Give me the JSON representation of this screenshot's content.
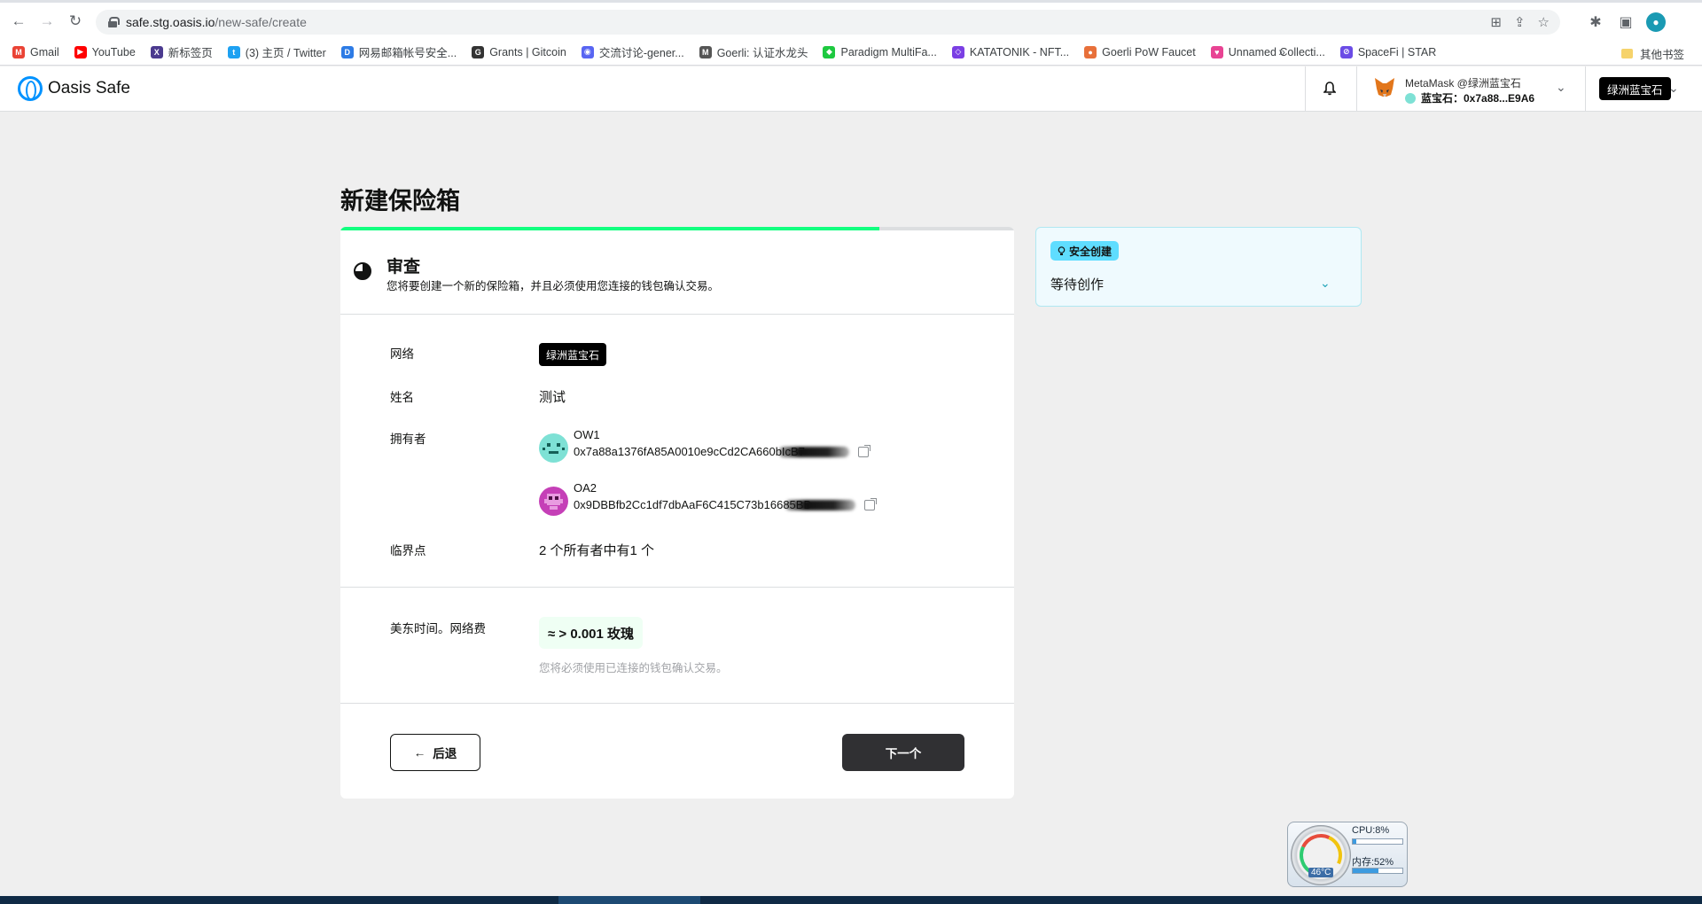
{
  "browser": {
    "url_host": "safe.stg.oasis.io",
    "url_path": "/new-safe/create",
    "bookmarks": [
      {
        "label": "Gmail",
        "color": "#ea4335",
        "glyph": "M"
      },
      {
        "label": "YouTube",
        "color": "#ff0000",
        "glyph": "▶"
      },
      {
        "label": "新标签页",
        "color": "#4b3a8f",
        "glyph": "X"
      },
      {
        "label": "(3) 主页 / Twitter",
        "color": "#1da1f2",
        "glyph": "t"
      },
      {
        "label": "网易邮箱帐号安全...",
        "color": "#2d7be5",
        "glyph": "D"
      },
      {
        "label": "Grants | Gitcoin",
        "color": "#333333",
        "glyph": "G"
      },
      {
        "label": "交流讨论-gener...",
        "color": "#5865f2",
        "glyph": "◉"
      },
      {
        "label": "Goerli: 认证水龙头",
        "color": "#555555",
        "glyph": "M"
      },
      {
        "label": "Paradigm MultiFa...",
        "color": "#1ec940",
        "glyph": "◆"
      },
      {
        "label": "KATATONIK - NFT...",
        "color": "#7b3fe4",
        "glyph": "◇"
      },
      {
        "label": "Goerli PoW Faucet",
        "color": "#e8703a",
        "glyph": "●"
      },
      {
        "label": "Unnamed Collecti...",
        "color": "#e84393",
        "glyph": "♥"
      },
      {
        "label": "SpaceFi | STAR",
        "color": "#6b4ce6",
        "glyph": "⊘"
      }
    ],
    "more_label": "»",
    "other_bookmarks": "其他书签"
  },
  "header": {
    "app_name": "Oasis Safe",
    "wallet_name": "MetaMask @绿洲蓝宝石",
    "wallet_address": "蓝宝石：0x7a88...E9A6",
    "network": "绿洲蓝宝石"
  },
  "page": {
    "title": "新建保险箱",
    "progress_percent": 80,
    "step_title": "审查",
    "step_subtitle": "您将要创建一个新的保险箱，并且必须使用您连接的钱包确认交易。",
    "labels": {
      "network": "网络",
      "name": "姓名",
      "owners": "拥有者",
      "threshold": "临界点",
      "fee": "美东时间。网络费"
    },
    "values": {
      "network": "绿洲蓝宝石",
      "name": "测试",
      "threshold": "2 个所有者中有1 个",
      "fee": "≈ > 0.001 玫瑰",
      "fee_note": "您将必须使用已连接的钱包确认交易。"
    },
    "owners": [
      {
        "name": "OW1",
        "address": "0x7a88a1376fA85A0010e9cCd2CA660bIcB7"
      },
      {
        "name": "OA2",
        "address": "0x9DBBfb2Cc1df7dbAaF6C415C73b16685BB"
      }
    ],
    "back_label": "后退",
    "next_label": "下一个"
  },
  "side": {
    "badge": "安全创建",
    "status": "等待创作"
  },
  "widget": {
    "cpu": "CPU:8%",
    "cpu_percent": 8,
    "mem": "内存:52%",
    "mem_percent": 52,
    "temp": "46°C"
  }
}
